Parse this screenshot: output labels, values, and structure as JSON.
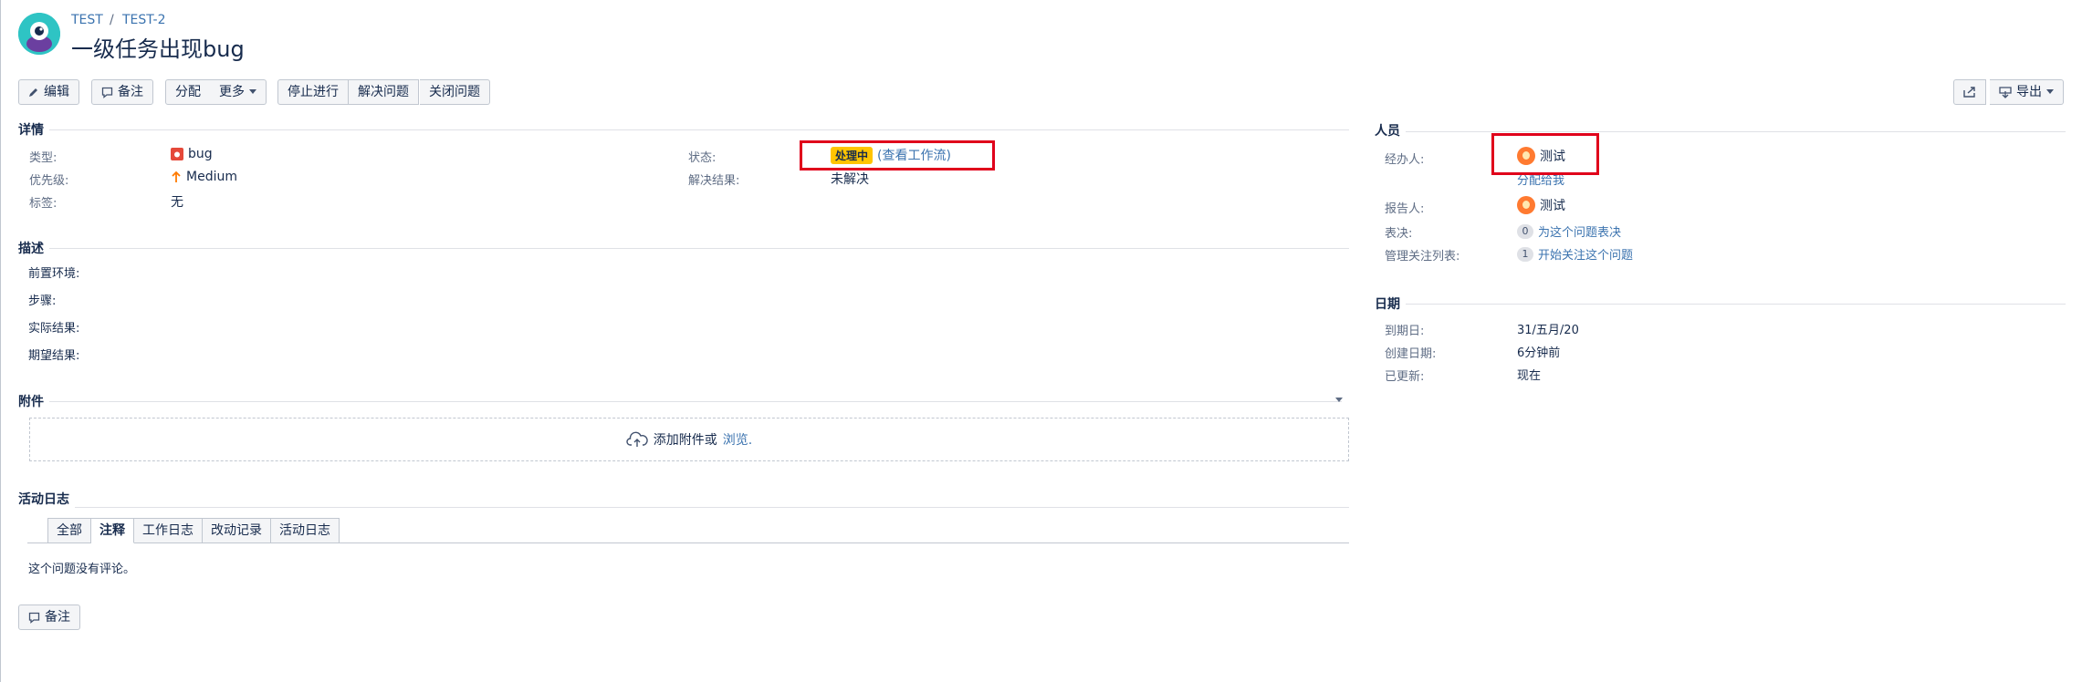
{
  "breadcrumb": {
    "project": "TEST",
    "sep": "/",
    "issue_key": "TEST-2"
  },
  "issue": {
    "title": "一级任务出现bug"
  },
  "toolbar": {
    "edit": "编辑",
    "comment": "备注",
    "assign": "分配",
    "more": "更多",
    "stop_progress": "停止进行",
    "resolve": "解决问题",
    "close": "关闭问题",
    "export": "导出"
  },
  "details": {
    "heading": "详情",
    "type_label": "类型:",
    "type_value": "bug",
    "priority_label": "优先级:",
    "priority_value": "Medium",
    "labels_label": "标签:",
    "labels_value": "无",
    "status_label": "状态:",
    "status_value": "处理中",
    "workflow_link": "(查看工作流)",
    "resolution_label": "解决结果:",
    "resolution_value": "未解决"
  },
  "description": {
    "heading": "描述",
    "lines": [
      "前置环境:",
      "步骤:",
      "实际结果:",
      "期望结果:"
    ]
  },
  "attachments": {
    "heading": "附件",
    "drop_text": "添加附件或",
    "browse": "浏览."
  },
  "activity": {
    "heading": "活动日志",
    "tabs": [
      "全部",
      "注释",
      "工作日志",
      "改动记录",
      "活动日志"
    ],
    "active_tab": 1,
    "empty_text": "这个问题没有评论。",
    "comment_button": "备注"
  },
  "people": {
    "heading": "人员",
    "assignee_label": "经办人:",
    "assignee_value": "测试",
    "assign_to_me": "分配给我",
    "reporter_label": "报告人:",
    "reporter_value": "测试",
    "votes_label": "表决:",
    "votes_count": "0",
    "votes_link": "为这个问题表决",
    "watchers_label": "管理关注列表:",
    "watchers_count": "1",
    "watchers_link": "开始关注这个问题"
  },
  "dates": {
    "heading": "日期",
    "due_label": "到期日:",
    "due_value": "31/五月/20",
    "created_label": "创建日期:",
    "created_value": "6分钟前",
    "updated_label": "已更新:",
    "updated_value": "现在"
  },
  "colors": {
    "link": "#3b73af",
    "status_badge": "#ffc400",
    "highlight_box": "#e0001b",
    "bug_icon": "#e5493a",
    "priority_medium": "#ff7a00"
  },
  "icons": [
    "project-avatar-icon",
    "pencil-icon",
    "comment-icon",
    "caret-down-icon",
    "bug-icon",
    "arrow-up-icon",
    "share-icon",
    "export-icon",
    "upload-cloud-icon",
    "user-avatar-icon"
  ]
}
